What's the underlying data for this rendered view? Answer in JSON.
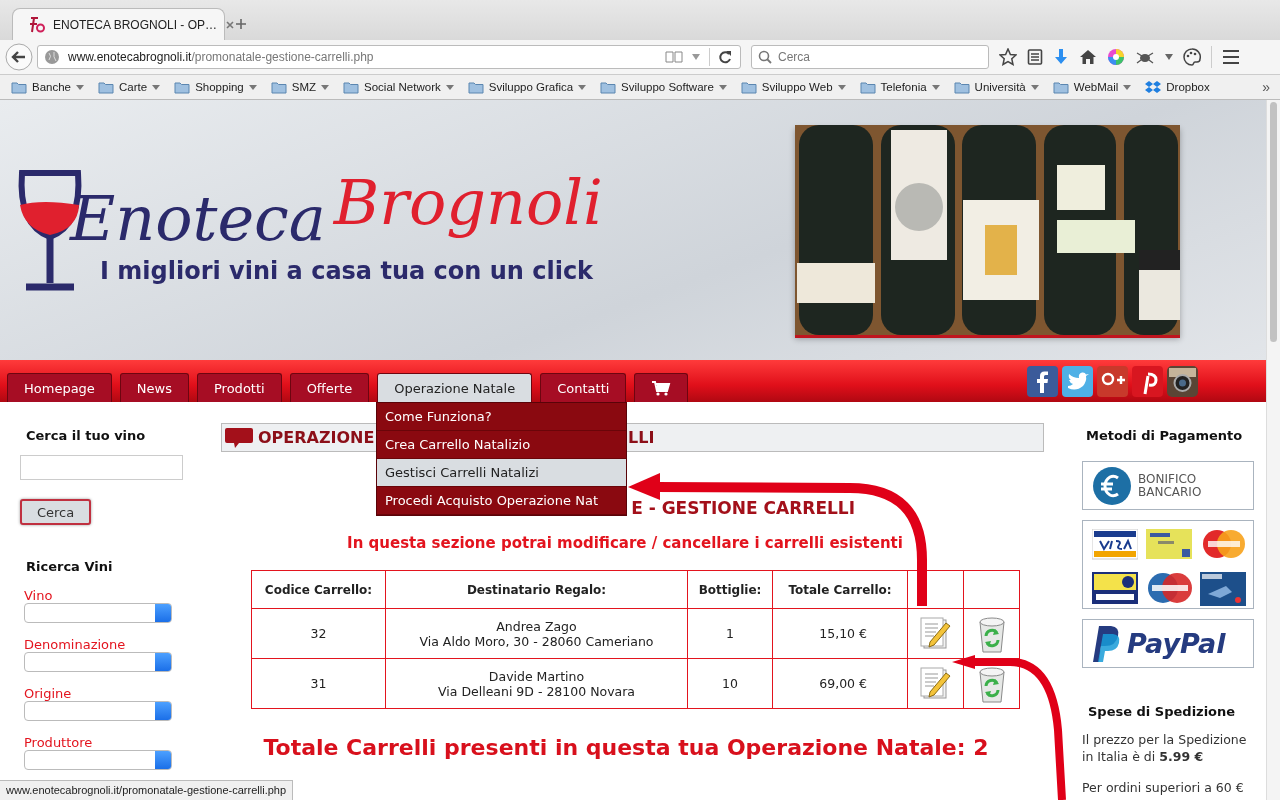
{
  "browser": {
    "tab": {
      "title": "ENOTECA BROGNOLI - OP…",
      "selected": true
    },
    "url": {
      "domain": "www.enotecabrognoli.it",
      "path": "/promonatale-gestione-carrelli.php"
    },
    "search": {
      "placeholder": "Cerca"
    },
    "bookmarks": [
      {
        "label": "Banche",
        "kind": "folder"
      },
      {
        "label": "Carte",
        "kind": "folder"
      },
      {
        "label": "Shopping",
        "kind": "folder"
      },
      {
        "label": "SMZ",
        "kind": "folder"
      },
      {
        "label": "Social Network",
        "kind": "folder"
      },
      {
        "label": "Sviluppo Grafica",
        "kind": "folder"
      },
      {
        "label": "Sviluppo Software",
        "kind": "folder"
      },
      {
        "label": "Sviluppo Web",
        "kind": "folder"
      },
      {
        "label": "Telefonia",
        "kind": "folder"
      },
      {
        "label": "Università",
        "kind": "folder"
      },
      {
        "label": "WebMail",
        "kind": "folder"
      },
      {
        "label": "Dropbox",
        "kind": "link"
      }
    ],
    "overflow": "»"
  },
  "header": {
    "logo": {
      "part_1": "Enoteca",
      "part_2": "Brognoli",
      "tagline": "I migliori vini a casa tua con un click"
    }
  },
  "nav": {
    "tabs": [
      {
        "kind": "text",
        "label": "Homepage",
        "selected": false
      },
      {
        "kind": "text",
        "label": "News",
        "selected": false
      },
      {
        "kind": "text",
        "label": "Prodotti",
        "selected": false
      },
      {
        "kind": "text",
        "label": "Offerte",
        "selected": false
      },
      {
        "kind": "text",
        "label": "Operazione Natale",
        "selected": true
      },
      {
        "kind": "text",
        "label": "Contatti",
        "selected": false
      },
      {
        "kind": "cart",
        "selected": false
      }
    ],
    "dropdown": [
      {
        "label": "Come Funziona?",
        "selected": false
      },
      {
        "label": "Crea Carrello Natalizio",
        "selected": false
      },
      {
        "label": "Gestisci Carrelli Natalizi",
        "selected": true
      },
      {
        "label": "Procedi Acquisto Operazione Nat",
        "selected": false
      }
    ]
  },
  "left": {
    "search": {
      "title": "Cerca il tuo vino",
      "button": "Cerca"
    },
    "filters": {
      "title": "Ricerca Vini",
      "selects": [
        {
          "label": "Vino"
        },
        {
          "label": "Denominazione"
        },
        {
          "label": "Origine"
        },
        {
          "label": "Produttore"
        }
      ]
    }
  },
  "main": {
    "heading_bar": {
      "text_start": "OPERAZIONE",
      "text_end": "LLI"
    },
    "title": "E - GESTIONE CARRELLI",
    "subtitle": "In questa sezione potrai modificare / cancellare i carrelli esistenti",
    "table": {
      "columns": [
        "Codice Carrello:",
        "Destinatario Regalo:",
        "Bottiglie:",
        "Totale Carrello:"
      ],
      "rows": [
        {
          "code": "32",
          "recipient": "Andrea Zago",
          "address": "Via Aldo Moro, 30 - 28060 Cameriano",
          "bottles": "1",
          "total": "15,10 €"
        },
        {
          "code": "31",
          "recipient": "Davide Martino",
          "address": "Via Delleani 9D - 28100 Novara",
          "bottles": "10",
          "total": "69,00 €"
        }
      ]
    },
    "summary": "Totale Carrelli presenti in questa tua Operazione Natale: 2"
  },
  "right": {
    "payment_title": "Metodi di Pagamento",
    "bank_transfer": {
      "line_1": "BONIFICO",
      "line_2": "BANCARIO"
    },
    "paypal": "PayPal",
    "shipping_title": "Spese di Spedizione",
    "shipping_text": "Il prezzo per la Spedizione in Italia è di **5.99 €**",
    "shipping_text_2": "Per ordini superiori a 60 €"
  },
  "status_bar": "www.enotecabrognoli.it/promonatale-gestione-carrelli.php"
}
